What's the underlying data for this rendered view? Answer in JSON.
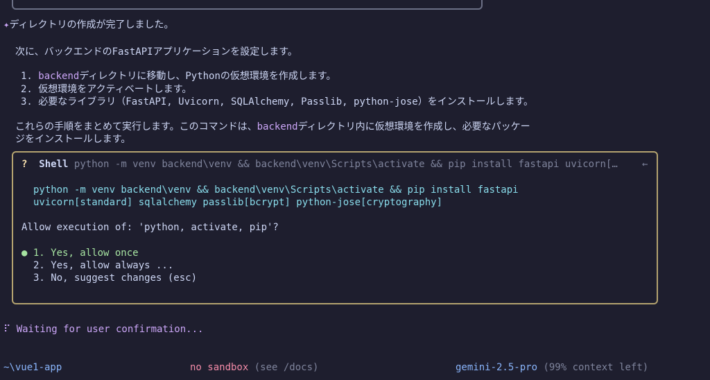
{
  "status_line": {
    "icon": "✦",
    "text": "ディレクトリの作成が完了しました。"
  },
  "message": {
    "intro": "次に、バックエンドのFastAPIアプリケーションを設定します。",
    "steps": [
      {
        "num": "1.",
        "highlight": "backend",
        "rest": "ディレクトリに移動し、Pythonの仮想環境を作成します。"
      },
      {
        "num": "2.",
        "highlight": "",
        "rest": "仮想環境をアクティベートします。"
      },
      {
        "num": "3.",
        "highlight": "",
        "rest": "必要なライブラリ（FastAPI, Uvicorn, SQLAlchemy, Passlib, python-jose）をインストールします。"
      }
    ],
    "summary_pre": "これらの手順をまとめて実行します。このコマンドは、",
    "summary_hl": "backend",
    "summary_post": "ディレクトリ内に仮想環境を作成し、必要なパッケー",
    "summary_line2": "ジをインストールします。"
  },
  "prompt": {
    "q_mark": "?",
    "tool": "Shell",
    "header_cmd": "python -m venv backend\\venv && backend\\venv\\Scripts\\activate && pip install fastapi uvicorn[…",
    "arrow": "←",
    "cmd_line1": "python -m venv backend\\venv && backend\\venv\\Scripts\\activate && pip install fastapi",
    "cmd_line2": "uvicorn[standard] sqlalchemy passlib[bcrypt] python-jose[cryptography]",
    "question": "Allow execution of: 'python, activate, pip'?",
    "bullet": "●",
    "options": [
      "1. Yes, allow once",
      "2. Yes, allow always ...",
      "3. No, suggest changes (esc)"
    ]
  },
  "waiting": {
    "spinner": "⠏",
    "text": "Waiting for user confirmation..."
  },
  "footer": {
    "path": "~\\vue1-app",
    "sandbox": "no sandbox",
    "sandbox_hint": "(see /docs)",
    "model": "gemini-2.5-pro",
    "context": "(99% context left)"
  },
  "colors": {
    "background": "#1e1e2e",
    "accent_purple": "#cba6f7",
    "prompt_border": "#b4a36f",
    "command_cyan": "#89dceb",
    "selected_green": "#a6e3a1",
    "sandbox_pink": "#f38ba8",
    "model_blue": "#89b4fa"
  }
}
